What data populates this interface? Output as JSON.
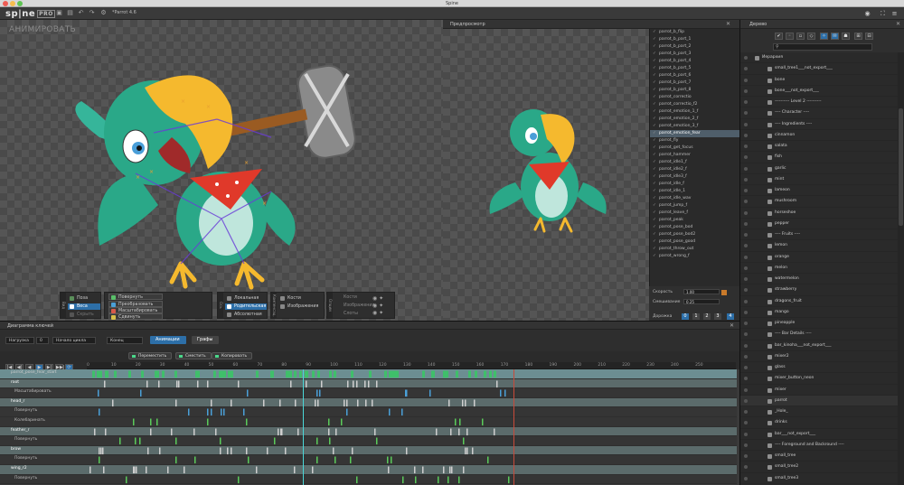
{
  "window": {
    "title": "Spine"
  },
  "app": {
    "logo": "sp|ne",
    "edition": "PRO",
    "project_title": "*Parrot 4.6"
  },
  "main_view": {
    "mode_label": "АНИМИРОВАТЬ"
  },
  "preview": {
    "title": "Предпросмотр"
  },
  "tree": {
    "title": "Дерево"
  },
  "anim_list": [
    "parrot_b_flip",
    "parrot_b_part_1",
    "parrot_b_part_2",
    "parrot_b_part_3",
    "parrot_b_part_4",
    "parrot_b_part_5",
    "parrot_b_part_6",
    "parrot_b_part_7",
    "parrot_b_part_8",
    "parrot_correctio",
    "parrot_correctio_f2",
    "parrot_emotion_1_f",
    "parrot_emotion_2_f",
    "parrot_emotion_3_f",
    "parrot_emotion_fear",
    "parrot_fly",
    "parrot_get_focus",
    "parrot_hammer",
    "parrot_idle1_f",
    "parrot_idle2_f",
    "parrot_idle3_f",
    "parrot_idle_f",
    "parrot_idle_1",
    "parrot_idle_wav",
    "parrot_jump_f",
    "parrot_leave_f",
    "parrot_peak",
    "parrot_pose_bod",
    "parrot_pose_bod2",
    "parrot_pose_good",
    "parrot_throw_out",
    "parrot_wrong_f"
  ],
  "anim_list_selected_index": 14,
  "preview_ctrl": {
    "speed_label": "Скорость",
    "speed_value": "1.00",
    "mix_label": "Смешивание",
    "mix_value": "0.25",
    "tracks_label": "Дорожка",
    "track_buttons": [
      "0",
      "1",
      "2",
      "3",
      "4"
    ]
  },
  "tool_groups": {
    "view": {
      "side": "Вид",
      "items": [
        "Поза",
        "Веса",
        "Скрыть"
      ]
    },
    "transform": {
      "items": [
        "Повернуть",
        "Преобразовать",
        "Масштабировать",
        "Сдвинуть"
      ]
    },
    "axes": {
      "side": "Ось",
      "items": [
        "Локальная",
        "Родительская",
        "Абсолютная"
      ]
    },
    "compensate": {
      "side": "Компенсац.",
      "items": [
        "Кости",
        "Изображения"
      ]
    },
    "options": {
      "side": "Опции",
      "items": [
        "Кости",
        "Изображения",
        "Слоты"
      ]
    }
  },
  "dopesheet": {
    "title": "Диаграмма ключей",
    "fields": {
      "loop_start": "Нагрузка",
      "loop_start_val": "0",
      "loop_end": "Начало цикла",
      "end_label": "Конец"
    },
    "mode_buttons": [
      "Анимации",
      "Графы"
    ],
    "key_buttons": [
      "Переместить",
      "Сместить",
      "Копировать"
    ],
    "transport": [
      "|◀",
      "◀|",
      "◀",
      "▶",
      "▶|",
      "▶▶|",
      "⟳"
    ],
    "ruler_ticks": [
      "0",
      "10",
      "20",
      "30",
      "40",
      "50",
      "60",
      "70",
      "80",
      "90",
      "100",
      "110",
      "120",
      "130",
      "140",
      "150",
      "160",
      "170",
      "180",
      "190",
      "200",
      "210",
      "220",
      "230",
      "240",
      "250"
    ],
    "rows": [
      {
        "label": "parrot_pose_fear_start",
        "type": "sel"
      },
      {
        "label": "root",
        "type": "bone"
      },
      {
        "label": "Масштабировать",
        "type": "attr"
      },
      {
        "label": "head_r",
        "type": "bone"
      },
      {
        "label": "Повернуть",
        "type": "attr"
      },
      {
        "label": "Колебаринать",
        "type": "attr"
      },
      {
        "label": "feather_r",
        "type": "bone"
      },
      {
        "label": "Повернуть",
        "type": "attr"
      },
      {
        "label": "brow",
        "type": "bone"
      },
      {
        "label": "Повернуть",
        "type": "attr"
      },
      {
        "label": "wing_r2",
        "type": "bone"
      },
      {
        "label": "Повернуть",
        "type": "attr"
      }
    ]
  },
  "tree_items": [
    {
      "label": "Иерархия",
      "color": "#aaa"
    },
    {
      "label": "small_tree1___not_export___",
      "color": "#aaa"
    },
    {
      "label": "bone",
      "color": "#aaa"
    },
    {
      "label": "bone___not_export___",
      "color": "#aaa"
    },
    {
      "label": "---------- Level 2 ----------",
      "color": "#aaa"
    },
    {
      "label": "---- Character ----",
      "color": "#aaa"
    },
    {
      "label": "---- Ingredients ----",
      "color": "#aaa"
    },
    {
      "label": "cinnamon",
      "color": "#aaa"
    },
    {
      "label": "salata",
      "color": "#aaa"
    },
    {
      "label": "fish",
      "color": "#aaa"
    },
    {
      "label": "garlic",
      "color": "#aaa"
    },
    {
      "label": "mint",
      "color": "#aaa"
    },
    {
      "label": "lameon",
      "color": "#aaa"
    },
    {
      "label": "mushroom",
      "color": "#aaa"
    },
    {
      "label": "horseshoe",
      "color": "#aaa"
    },
    {
      "label": "pepper",
      "color": "#aaa"
    },
    {
      "label": "---- Fruits ----",
      "color": "#aaa"
    },
    {
      "label": "lemon",
      "color": "#aaa"
    },
    {
      "label": "orange",
      "color": "#aaa"
    },
    {
      "label": "melon",
      "color": "#aaa"
    },
    {
      "label": "watermelon",
      "color": "#aaa"
    },
    {
      "label": "strawberry",
      "color": "#aaa"
    },
    {
      "label": "dragons_fruit",
      "color": "#aaa"
    },
    {
      "label": "mango",
      "color": "#aaa"
    },
    {
      "label": "pineapple",
      "color": "#aaa"
    },
    {
      "label": "---- Bar Details ----",
      "color": "#aaa"
    },
    {
      "label": "bar_kinoha___not_export___",
      "color": "#aaa"
    },
    {
      "label": "mixer2",
      "color": "#aaa"
    },
    {
      "label": "glass",
      "color": "#aaa"
    },
    {
      "label": "mixer_button_neon",
      "color": "#aaa"
    },
    {
      "label": "mixer",
      "color": "#aaa"
    },
    {
      "label": "parrot",
      "color": "#aaa"
    },
    {
      "label": "_Hole_",
      "color": "#aaa"
    },
    {
      "label": "drinks",
      "color": "#aaa"
    },
    {
      "label": "bar___not_export___",
      "color": "#aaa"
    },
    {
      "label": "---- Foreground and Backround ----",
      "color": "#aaa"
    },
    {
      "label": "small_tree",
      "color": "#aaa"
    },
    {
      "label": "small_tree2",
      "color": "#aaa"
    },
    {
      "label": "small_tree3",
      "color": "#aaa"
    },
    {
      "label": "green_band_13_b",
      "color": "#aaa"
    }
  ],
  "colors": {
    "accent": "#2d6fa8",
    "orange": "#c97a2a",
    "parrot_green": "#2aa888",
    "beak": "#f5b92e",
    "bandana": "#e0392a"
  }
}
